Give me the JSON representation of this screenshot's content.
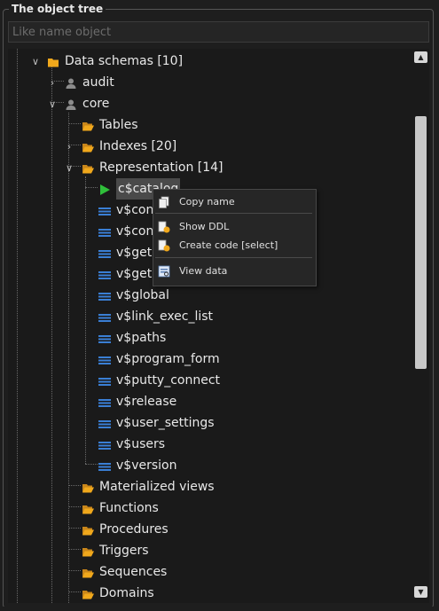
{
  "panel": {
    "title": "The object tree",
    "filter_placeholder": "Like name object"
  },
  "tree": {
    "rows": [
      {
        "label": "Data schemas [10]",
        "icon": "folder-icon",
        "expander": "expanded"
      },
      {
        "label": "audit",
        "icon": "user-icon",
        "expander": "collapsed"
      },
      {
        "label": "core",
        "icon": "user-icon",
        "expander": "expanded"
      },
      {
        "label": "Tables",
        "icon": "folder-open-icon",
        "expander": "none"
      },
      {
        "label": "Indexes [20]",
        "icon": "folder-open-icon",
        "expander": "collapsed"
      },
      {
        "label": "Representation [14]",
        "icon": "folder-open-icon",
        "expander": "expanded"
      },
      {
        "label": "c$catalog",
        "icon": "play-icon",
        "expander": "none",
        "selected": true
      },
      {
        "label": "v$con",
        "icon": "view-icon",
        "expander": "none"
      },
      {
        "label": "v$con",
        "icon": "view-icon",
        "expander": "none"
      },
      {
        "label": "v$get",
        "icon": "view-icon",
        "expander": "none"
      },
      {
        "label": "v$get",
        "icon": "view-icon",
        "expander": "none"
      },
      {
        "label": "v$global",
        "icon": "view-icon",
        "expander": "none"
      },
      {
        "label": "v$link_exec_list",
        "icon": "view-icon",
        "expander": "none"
      },
      {
        "label": "v$paths",
        "icon": "view-icon",
        "expander": "none"
      },
      {
        "label": "v$program_form",
        "icon": "view-icon",
        "expander": "none"
      },
      {
        "label": "v$putty_connect",
        "icon": "view-icon",
        "expander": "none"
      },
      {
        "label": "v$release",
        "icon": "view-icon",
        "expander": "none"
      },
      {
        "label": "v$user_settings",
        "icon": "view-icon",
        "expander": "none"
      },
      {
        "label": "v$users",
        "icon": "view-icon",
        "expander": "none"
      },
      {
        "label": "v$version",
        "icon": "view-icon",
        "expander": "none"
      },
      {
        "label": "Materialized views",
        "icon": "folder-open-icon",
        "expander": "none"
      },
      {
        "label": "Functions",
        "icon": "folder-open-icon",
        "expander": "none"
      },
      {
        "label": "Procedures",
        "icon": "folder-open-icon",
        "expander": "none"
      },
      {
        "label": "Triggers",
        "icon": "folder-open-icon",
        "expander": "none"
      },
      {
        "label": "Sequences",
        "icon": "folder-open-icon",
        "expander": "none"
      },
      {
        "label": "Domains",
        "icon": "folder-open-icon",
        "expander": "none"
      }
    ]
  },
  "context_menu": {
    "items": [
      {
        "label": "Copy name",
        "icon": "copy-icon"
      },
      {
        "label": "Show DDL",
        "icon": "ddl-icon"
      },
      {
        "label": "Create code [select]",
        "icon": "code-icon"
      },
      {
        "label": "View data",
        "icon": "view-data-icon"
      }
    ]
  },
  "colors": {
    "background": "#1e1e1e",
    "folder": "#f0a81c",
    "view_icon": "#3a7fd5",
    "play": "#2fbf3a",
    "selection": "#4a4a4a"
  }
}
